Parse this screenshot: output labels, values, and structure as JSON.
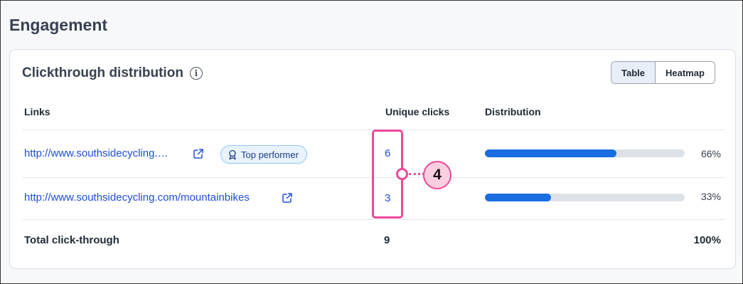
{
  "section_title": "Engagement",
  "card": {
    "title": "Clickthrough distribution",
    "info_icon": "info-icon",
    "view_toggle": [
      {
        "label": "Table",
        "active": true
      },
      {
        "label": "Heatmap",
        "active": false
      }
    ]
  },
  "table": {
    "headers": {
      "links": "Links",
      "unique_clicks": "Unique clicks",
      "distribution": "Distribution"
    },
    "rows": [
      {
        "link": "http://www.southsidecycling.…",
        "badge": "Top performer",
        "unique_clicks": "6",
        "distribution_pct": "66%",
        "distribution_value": 0.66
      },
      {
        "link": "http://www.southsidecycling.com/mountainbikes",
        "unique_clicks": "3",
        "distribution_pct": "33%",
        "distribution_value": 0.33
      }
    ],
    "total": {
      "label": "Total click-through",
      "unique_clicks": "9",
      "distribution_pct": "100%"
    }
  },
  "annotation": {
    "callout_number": "4",
    "color": "#ec4899"
  },
  "colors": {
    "link": "#1d4ed8",
    "bar": "#1a6de0",
    "track": "#dde2e8"
  }
}
